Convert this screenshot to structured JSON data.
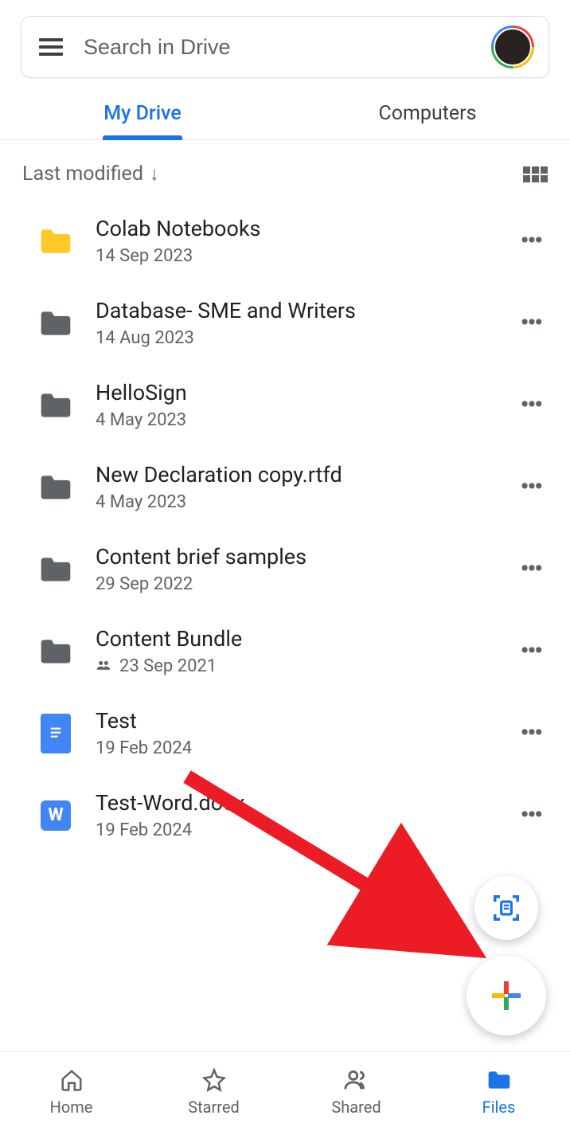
{
  "search": {
    "placeholder": "Search in Drive"
  },
  "tabs": [
    {
      "label": "My Drive",
      "active": true
    },
    {
      "label": "Computers",
      "active": false
    }
  ],
  "sort": {
    "label": "Last modified",
    "direction": "down"
  },
  "files": [
    {
      "name": "Colab Notebooks",
      "date": "14 Sep 2023",
      "type": "folder",
      "color": "#ffca28",
      "shared": false
    },
    {
      "name": "Database- SME and Writers",
      "date": "14 Aug 2023",
      "type": "folder",
      "color": "#5f6368",
      "shared": false
    },
    {
      "name": "HelloSign",
      "date": "4 May 2023",
      "type": "folder",
      "color": "#5f6368",
      "shared": false
    },
    {
      "name": "New Declaration copy.rtfd",
      "date": "4 May 2023",
      "type": "folder",
      "color": "#5f6368",
      "shared": false
    },
    {
      "name": "Content brief samples",
      "date": "29 Sep 2022",
      "type": "folder",
      "color": "#5f6368",
      "shared": false
    },
    {
      "name": "Content Bundle",
      "date": "23 Sep 2021",
      "type": "folder",
      "color": "#5f6368",
      "shared": true
    },
    {
      "name": "Test",
      "date": "19 Feb 2024",
      "type": "gdoc",
      "color": "#4285f4",
      "shared": false
    },
    {
      "name": "Test-Word.docx",
      "date": "19 Feb 2024",
      "type": "word",
      "color": "#4285f4",
      "shared": false
    }
  ],
  "bottom_nav": [
    {
      "label": "Home",
      "icon": "home",
      "active": false
    },
    {
      "label": "Starred",
      "icon": "star",
      "active": false
    },
    {
      "label": "Shared",
      "icon": "shared",
      "active": false
    },
    {
      "label": "Files",
      "icon": "files",
      "active": true
    }
  ],
  "annotation": {
    "arrow_color": "#ed1c24"
  }
}
